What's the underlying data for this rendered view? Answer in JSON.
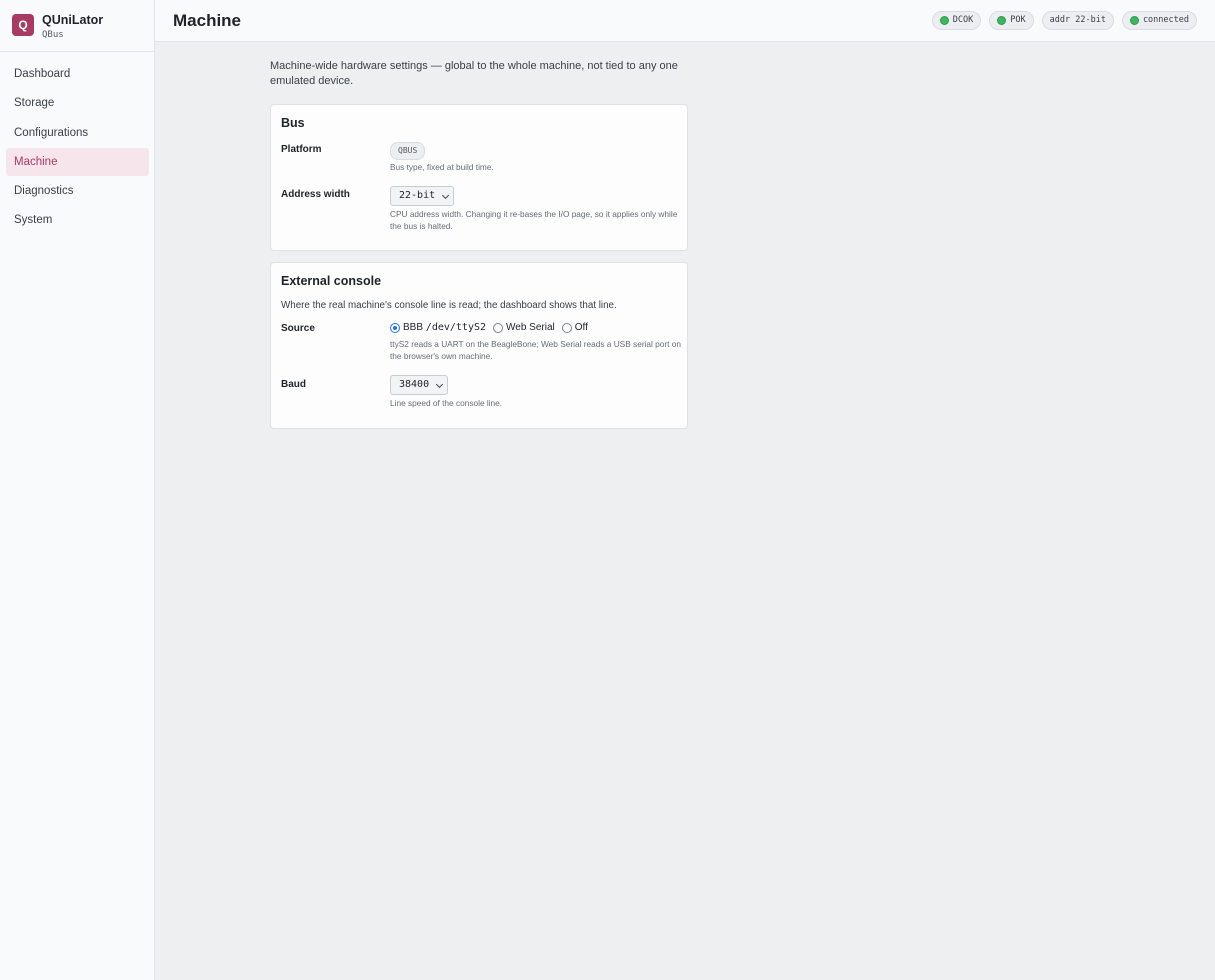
{
  "brand": {
    "logo_letter": "Q",
    "name": "QUniLator",
    "subtitle": "QBus"
  },
  "nav": {
    "items": [
      {
        "label": "Dashboard"
      },
      {
        "label": "Storage"
      },
      {
        "label": "Configurations"
      },
      {
        "label": "Machine",
        "active": true
      },
      {
        "label": "Diagnostics"
      },
      {
        "label": "System"
      }
    ]
  },
  "header": {
    "title": "Machine",
    "pills": {
      "dcok": "DCOK",
      "pok": "POK",
      "addr": "addr 22-bit",
      "connection": "connected"
    }
  },
  "intro": "Machine-wide hardware settings — global to the whole machine, not tied to any one emulated device.",
  "bus": {
    "title": "Bus",
    "platform_label": "Platform",
    "platform_value": "QBUS",
    "platform_help": "Bus type, fixed at build time.",
    "address_width_label": "Address width",
    "address_width_value": "22-bit",
    "address_width_help": "CPU address width. Changing it re-bases the I/O page, so it applies only while the bus is halted."
  },
  "console": {
    "title": "External console",
    "description": "Where the real machine's console line is read; the dashboard shows that line.",
    "source_label": "Source",
    "source_options": {
      "bbb_prefix": "BBB",
      "bbb_path": "/dev/ttyS2",
      "web_serial": "Web Serial",
      "off": "Off"
    },
    "source_selected": "BBB /dev/ttyS2",
    "source_help": "ttyS2 reads a UART on the BeagleBone; Web Serial reads a USB serial port on the browser's own machine.",
    "baud_label": "Baud",
    "baud_value": "38400",
    "baud_help": "Line speed of the console line."
  },
  "colors": {
    "accent": "#a83a63",
    "status_ok": "#3fb760",
    "radio_selected": "#1a73e8"
  }
}
